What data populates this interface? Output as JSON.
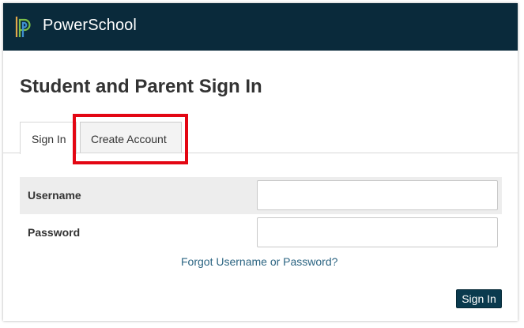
{
  "header": {
    "brand": "PowerSchool",
    "logo_icon": "powerschool-p-logo-icon",
    "background_color": "#0a2a3b"
  },
  "page": {
    "title": "Student and Parent Sign In"
  },
  "tabs": [
    {
      "label": "Sign In",
      "active": true
    },
    {
      "label": "Create Account",
      "active": false,
      "highlighted": true
    }
  ],
  "highlight_color": "#e30613",
  "form": {
    "username_label": "Username",
    "username_value": "",
    "password_label": "Password",
    "password_value": "",
    "forgot_link": "Forgot Username or Password?",
    "submit_label": "Sign In"
  }
}
